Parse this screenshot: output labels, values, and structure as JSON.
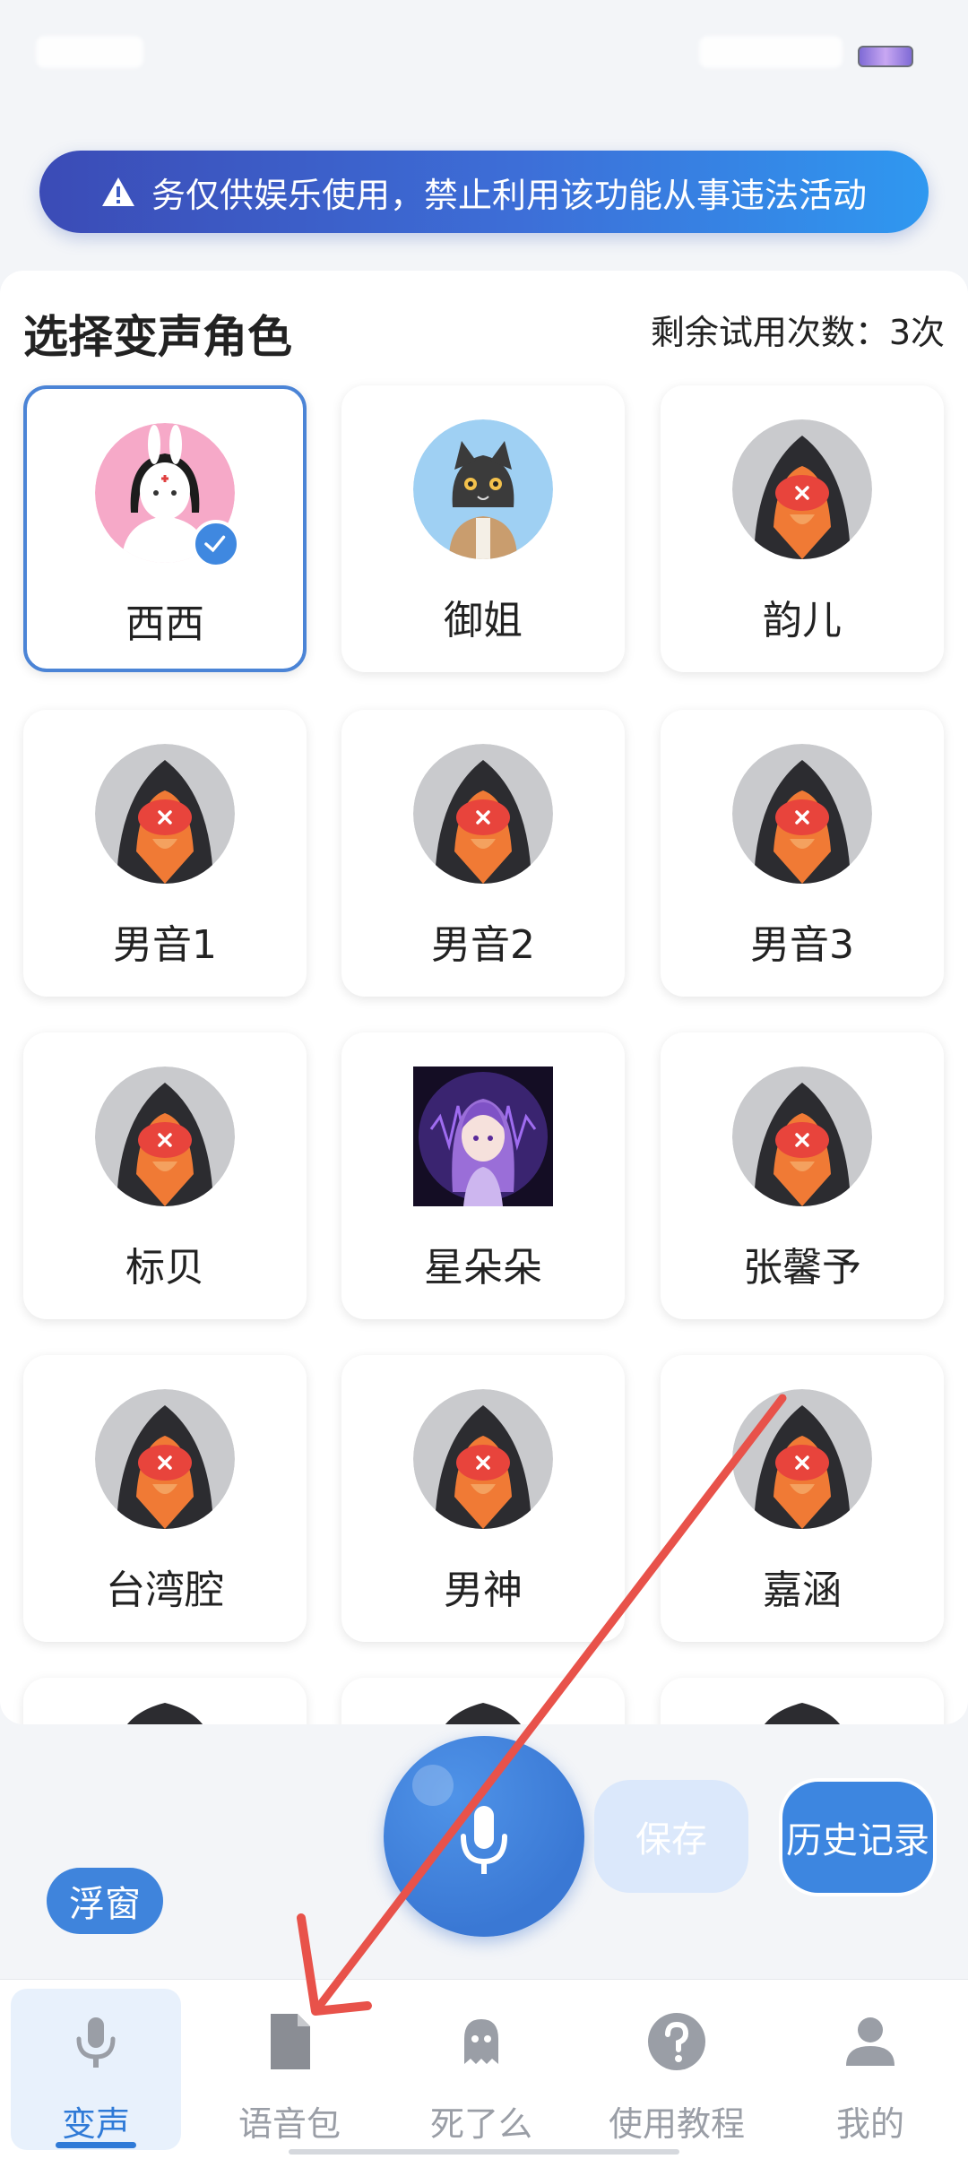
{
  "warning_banner": {
    "text": "务仅供娱乐使用，禁止利用该功能从事违法活动"
  },
  "panel": {
    "title": "选择变声角色",
    "remaining_trials": "剩余试用次数：3次"
  },
  "voices": [
    {
      "name": "西西",
      "avatar": "bunny-mask-girl",
      "selected": true
    },
    {
      "name": "御姐",
      "avatar": "cat-mask-girl",
      "selected": false
    },
    {
      "name": "韵儿",
      "avatar": "hooded-masked-figure",
      "selected": false
    },
    {
      "name": "男音1",
      "avatar": "hooded-masked-figure",
      "selected": false
    },
    {
      "name": "男音2",
      "avatar": "hooded-masked-figure",
      "selected": false
    },
    {
      "name": "男音3",
      "avatar": "hooded-masked-figure",
      "selected": false
    },
    {
      "name": "标贝",
      "avatar": "hooded-masked-figure",
      "selected": false
    },
    {
      "name": "星朵朵",
      "avatar": "purple-hair-anime-girl",
      "selected": false
    },
    {
      "name": "张馨予",
      "avatar": "hooded-masked-figure",
      "selected": false
    },
    {
      "name": "台湾腔",
      "avatar": "hooded-masked-figure",
      "selected": false
    },
    {
      "name": "男神",
      "avatar": "hooded-masked-figure",
      "selected": false
    },
    {
      "name": "嘉涵",
      "avatar": "hooded-masked-figure",
      "selected": false
    }
  ],
  "controls": {
    "float_label": "浮窗",
    "save_label": "保存",
    "history_label": "历史记录",
    "record_icon": "microphone-icon"
  },
  "tabs": [
    {
      "label": "变声",
      "icon": "microphone-icon",
      "active": true
    },
    {
      "label": "语音包",
      "icon": "document-icon",
      "active": false
    },
    {
      "label": "死了么",
      "icon": "ghost-icon",
      "active": false
    },
    {
      "label": "使用教程",
      "icon": "question-icon",
      "active": false
    },
    {
      "label": "我的",
      "icon": "person-icon",
      "active": false
    }
  ],
  "colors": {
    "accent": "#3d86e0",
    "annotation_arrow": "#e8524a"
  }
}
